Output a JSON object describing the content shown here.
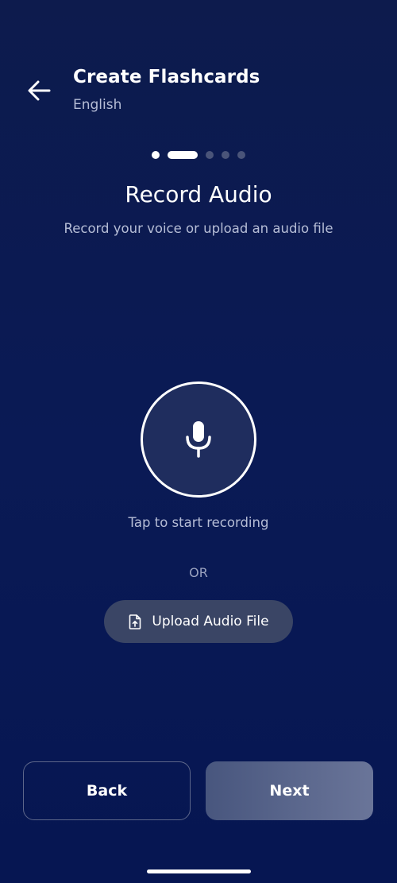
{
  "header": {
    "title": "Create Flashcards",
    "subtitle": "English",
    "back_icon": "arrow-left-icon"
  },
  "stepper": {
    "total_steps": 5,
    "current_step": 2
  },
  "step": {
    "title": "Record Audio",
    "subtitle": "Record your voice or upload an audio file"
  },
  "recorder": {
    "mic_icon": "microphone-icon",
    "hint": "Tap to start recording",
    "separator": "OR",
    "upload_label": "Upload Audio File",
    "upload_icon": "file-upload-icon"
  },
  "footer": {
    "back_label": "Back",
    "next_label": "Next"
  },
  "colors": {
    "background_top": "#0d1b4d",
    "background_bottom": "#061652",
    "muted_text": "#b6bdd6",
    "upload_button": "#3a4565",
    "next_button": "#5a6790"
  }
}
